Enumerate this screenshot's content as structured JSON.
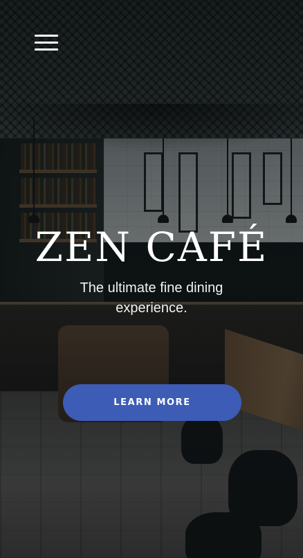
{
  "nav": {
    "menu_icon": "hamburger-menu-icon"
  },
  "hero": {
    "title": "ZEN CAFÉ",
    "subtitle": "The ultimate fine dining experience.",
    "cta_label": "LEARN MORE"
  },
  "colors": {
    "cta_background": "#3d5cb6",
    "text": "#ffffff"
  }
}
